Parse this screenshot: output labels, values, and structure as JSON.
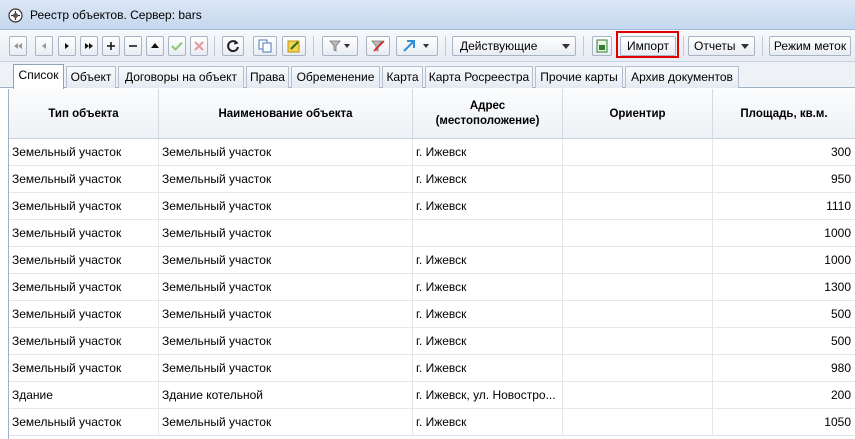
{
  "window": {
    "title": "Реестр объектов. Сервер: bars"
  },
  "toolbar": {
    "icons": [
      "first-icon",
      "prev-icon",
      "next-icon",
      "last-icon",
      "add-icon",
      "remove-icon",
      "up-icon",
      "check-icon",
      "cancel-icon",
      "refresh-icon",
      "copy-icon",
      "edit-icon",
      "filter-icon",
      "clear-filter-icon",
      "navigate-icon",
      "excel-icon"
    ],
    "status_filter": "Действующие",
    "import_label": "Импорт",
    "reports_label": "Отчеты",
    "tags_mode_label": "Режим меток"
  },
  "tabs": [
    "Список",
    "Объект",
    "Договоры на объект",
    "Права",
    "Обременение",
    "Карта",
    "Карта Росреестра",
    "Прочие карты",
    "Архив документов"
  ],
  "active_tab": "Список",
  "table": {
    "columns": [
      "Тип объекта",
      "Наименование объекта",
      "Адрес\n(местоположение)",
      "Ориентир",
      "Площадь, кв.м."
    ],
    "rows": [
      [
        "Земельный участок",
        "Земельный участок",
        "г. Ижевск",
        "",
        "300"
      ],
      [
        "Земельный участок",
        "Земельный участок",
        "г. Ижевск",
        "",
        "950"
      ],
      [
        "Земельный участок",
        "Земельный участок",
        "г. Ижевск",
        "",
        "1110"
      ],
      [
        "Земельный участок",
        "Земельный участок",
        "",
        "",
        "1000"
      ],
      [
        "Земельный участок",
        "Земельный участок",
        "г. Ижевск",
        "",
        "1000"
      ],
      [
        "Земельный участок",
        "Земельный участок",
        "г. Ижевск",
        "",
        "1300"
      ],
      [
        "Земельный участок",
        "Земельный участок",
        "г. Ижевск",
        "",
        "500"
      ],
      [
        "Земельный участок",
        "Земельный участок",
        "г. Ижевск",
        "",
        "500"
      ],
      [
        "Земельный участок",
        "Земельный участок",
        "г. Ижевск",
        "",
        "980"
      ],
      [
        "Здание",
        "Здание котельной",
        "г. Ижевск, ул. Новостро...",
        "",
        "200"
      ],
      [
        "Земельный участок",
        "Земельный участок",
        "г. Ижевск",
        "",
        "1050"
      ]
    ]
  },
  "colors": {
    "highlight": "#e00000",
    "tab_border": "#8ea2ba"
  }
}
